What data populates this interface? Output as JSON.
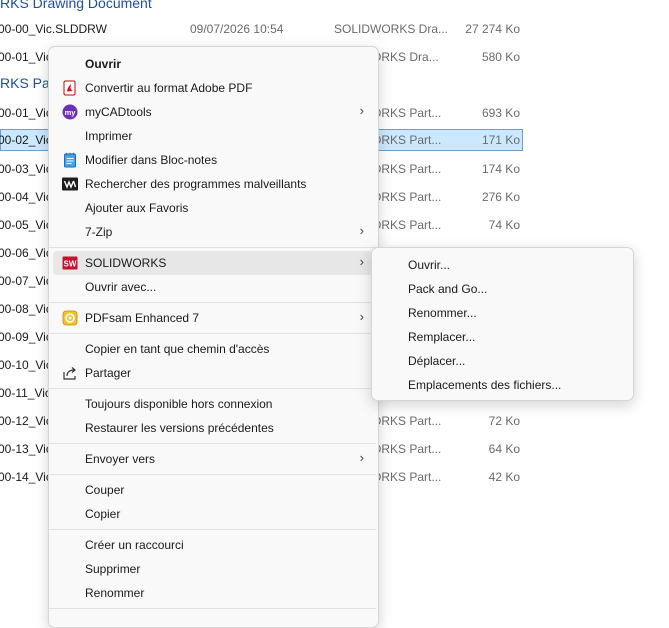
{
  "file_list": {
    "group_drawing": "RKS Drawing Document",
    "group_part": "RKS Par",
    "rows": [
      {
        "name": "00-00_Vic.SLDDRW",
        "date": "09/07/2026 10:54",
        "type": "SOLIDWORKS Dra...",
        "size": "27 274 Ko"
      },
      {
        "name": "00-01_Vic",
        "date": "",
        "type": "ORKS Dra...",
        "size": "580 Ko"
      },
      {
        "name": "00-01_Vic",
        "date": "",
        "type": "ORKS Part...",
        "size": "693 Ko"
      },
      {
        "name": "00-02_Vic",
        "date": "",
        "type": "ORKS Part...",
        "size": "171 Ko"
      },
      {
        "name": "00-03_Vic",
        "date": "",
        "type": "ORKS Part...",
        "size": "174 Ko"
      },
      {
        "name": "00-04_Vic",
        "date": "",
        "type": "ORKS Part...",
        "size": "276 Ko"
      },
      {
        "name": "00-05_Vic",
        "date": "",
        "type": "ORKS Part...",
        "size": "74 Ko"
      },
      {
        "name": "00-06_Vic",
        "date": "",
        "type": "",
        "size": ""
      },
      {
        "name": "00-07_Vic",
        "date": "",
        "type": "",
        "size": ""
      },
      {
        "name": "00-08_Vic",
        "date": "",
        "type": "",
        "size": ""
      },
      {
        "name": "00-09_Vic",
        "date": "",
        "type": "",
        "size": ""
      },
      {
        "name": "00-10_Vic",
        "date": "",
        "type": "",
        "size": ""
      },
      {
        "name": "00-11_Vic",
        "date": "",
        "type": "",
        "size": ""
      },
      {
        "name": "00-12_Vic",
        "date": "",
        "type": "ORKS Part...",
        "size": "72 Ko"
      },
      {
        "name": "00-13_Vic",
        "date": "",
        "type": "ORKS Part...",
        "size": "64 Ko"
      },
      {
        "name": "00-14_Vic",
        "date": "",
        "type": "ORKS Part...",
        "size": "42 Ko"
      }
    ]
  },
  "context_menu": {
    "open": "Ouvrir",
    "convert_pdf": "Convertir au format Adobe PDF",
    "mycadtools": "myCADtools",
    "print": "Imprimer",
    "edit_notepad": "Modifier dans Bloc-notes",
    "scan_malware": "Rechercher des programmes malveillants",
    "add_favorites": "Ajouter aux Favoris",
    "seven_zip": "7-Zip",
    "solidworks": "SOLIDWORKS",
    "open_with": "Ouvrir avec...",
    "pdfsam": "PDFsam Enhanced 7",
    "copy_path": "Copier en tant que chemin d'accès",
    "share": "Partager",
    "always_offline": "Toujours disponible hors connexion",
    "restore_versions": "Restaurer les versions précédentes",
    "send_to": "Envoyer vers",
    "cut": "Couper",
    "copy": "Copier",
    "create_shortcut": "Créer un raccourci",
    "delete": "Supprimer",
    "rename": "Renommer"
  },
  "submenu_solidworks": {
    "open": "Ouvrir...",
    "pack_and_go": "Pack and Go...",
    "rename": "Renommer...",
    "replace": "Remplacer...",
    "move": "Déplacer...",
    "file_locations": "Emplacements des fichiers..."
  },
  "icons": {
    "adobe_pdf": "pdf-icon",
    "mycadtools": "mycadtools-icon",
    "notepad": "notepad-icon",
    "malware": "malware-scan-icon",
    "solidworks": "solidworks-icon",
    "pdfsam": "pdfsam-icon",
    "share": "share-icon",
    "chevron": "chevron-right-icon"
  },
  "colors": {
    "accent_blue": "#1f4fa0",
    "selection_bg": "#cce8ff",
    "mycadtools_purple": "#6b2fb3",
    "solidworks_red": "#c8102e",
    "pdfsam_orange": "#e8a317"
  }
}
